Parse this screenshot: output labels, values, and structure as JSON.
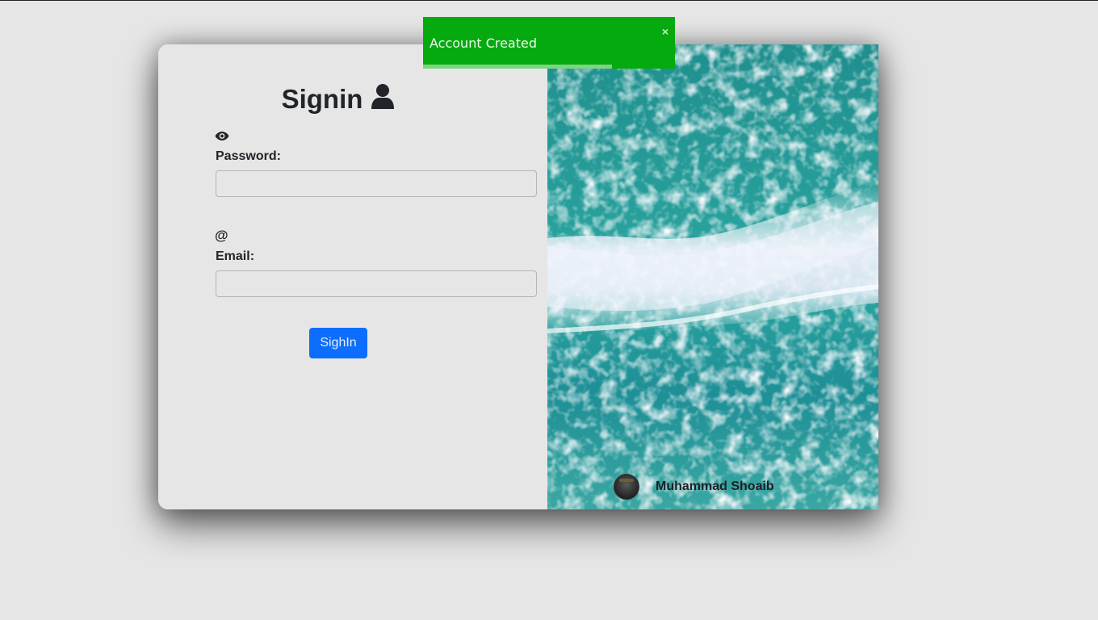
{
  "form": {
    "title": "Signin",
    "password_label": "Password:",
    "password_value": "",
    "email_label": "Email:",
    "email_value": "",
    "submit_label": "SighIn"
  },
  "icons": {
    "title_icon": "user-icon",
    "password_icon": "eye-icon",
    "email_icon": "at-icon"
  },
  "image_panel": {
    "author_name": "Muhammad Shoaib"
  },
  "toast": {
    "message": "Account Created",
    "close_glyph": "×",
    "progress": 0.75,
    "color": "#05aa0e"
  },
  "colors": {
    "accent": "#0d6efd",
    "background": "#e6e6e6"
  }
}
